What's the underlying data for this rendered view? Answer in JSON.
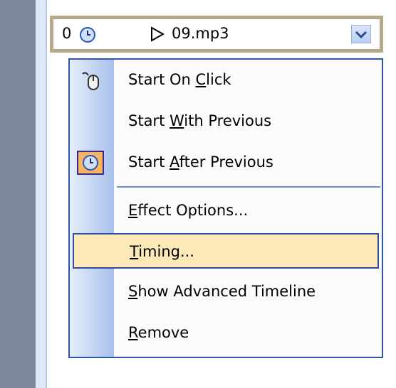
{
  "animation_item": {
    "order": "0",
    "timing_icon": "clock-icon",
    "effect_icon": "play-triangle-icon",
    "file_name": "09.mp3",
    "dropdown_icon": "chevron-down-icon"
  },
  "context_menu": {
    "items": [
      {
        "pre": "Start On ",
        "key": "C",
        "post": "lick",
        "icon": "mouse-icon",
        "checked": false
      },
      {
        "pre": "Start ",
        "key": "W",
        "post": "ith Previous",
        "icon": "",
        "checked": false
      },
      {
        "pre": "Start ",
        "key": "A",
        "post": "fter Previous",
        "icon": "clock-icon",
        "checked": true
      },
      {
        "pre": "",
        "key": "E",
        "post": "ffect Options...",
        "icon": "",
        "checked": false
      },
      {
        "pre": "",
        "key": "T",
        "post": "iming...",
        "icon": "",
        "checked": false,
        "highlighted": true
      },
      {
        "pre": "",
        "key": "S",
        "post": "how Advanced Timeline",
        "icon": "",
        "checked": false
      },
      {
        "pre": "",
        "key": "R",
        "post": "emove",
        "icon": "",
        "checked": false
      }
    ]
  },
  "colors": {
    "menu_border": "#2e56a8",
    "highlight_bg": "#fde9b8",
    "checked_bg": "#f7b461",
    "item_border": "#b5a88e"
  }
}
